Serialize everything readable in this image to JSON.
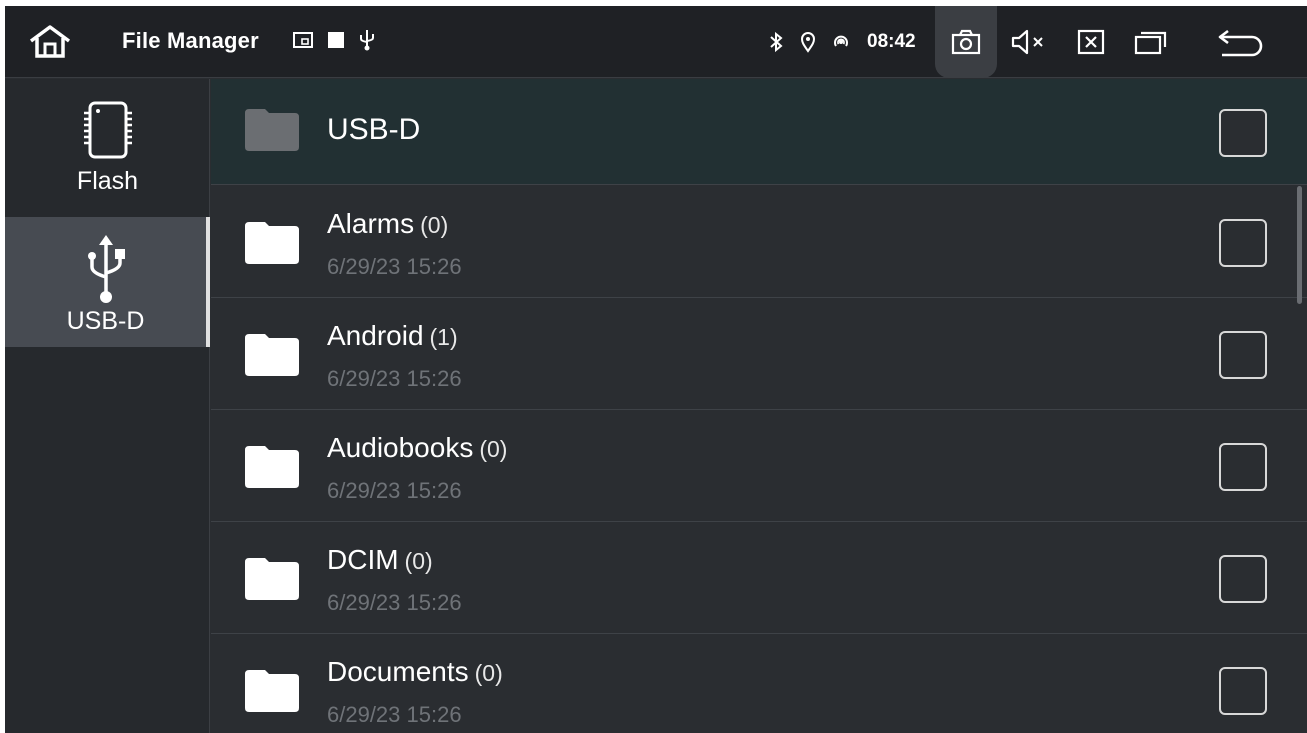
{
  "status_bar": {
    "title": "File Manager",
    "time": "08:42",
    "icons": [
      "home-icon",
      "screen-mirror-icon",
      "stop-square-icon",
      "usb-icon",
      "bluetooth-icon",
      "location-icon",
      "hotspot-icon",
      "screenshot-icon",
      "mute-icon",
      "close-window-icon",
      "recent-apps-icon",
      "back-icon"
    ]
  },
  "sidebar": {
    "items": [
      {
        "label": "Flash",
        "icon": "sd-card-icon",
        "active": false
      },
      {
        "label": "USB-D",
        "icon": "usb-icon",
        "active": true
      }
    ]
  },
  "list": {
    "header": {
      "name": "USB-D",
      "icon": "folder-icon"
    },
    "rows": [
      {
        "name": "Alarms",
        "count": "(0)",
        "date": "6/29/23 15:26"
      },
      {
        "name": "Android",
        "count": "(1)",
        "date": "6/29/23 15:26"
      },
      {
        "name": "Audiobooks",
        "count": "(0)",
        "date": "6/29/23 15:26"
      },
      {
        "name": "DCIM",
        "count": "(0)",
        "date": "6/29/23 15:26"
      },
      {
        "name": "Documents",
        "count": "(0)",
        "date": "6/29/23 15:26"
      }
    ]
  },
  "colors": {
    "background": "#2a2d31",
    "status_bar": "#1f2125",
    "header_row": "#223033",
    "sidebar_active": "#474b52",
    "date_text": "#6f7378"
  }
}
